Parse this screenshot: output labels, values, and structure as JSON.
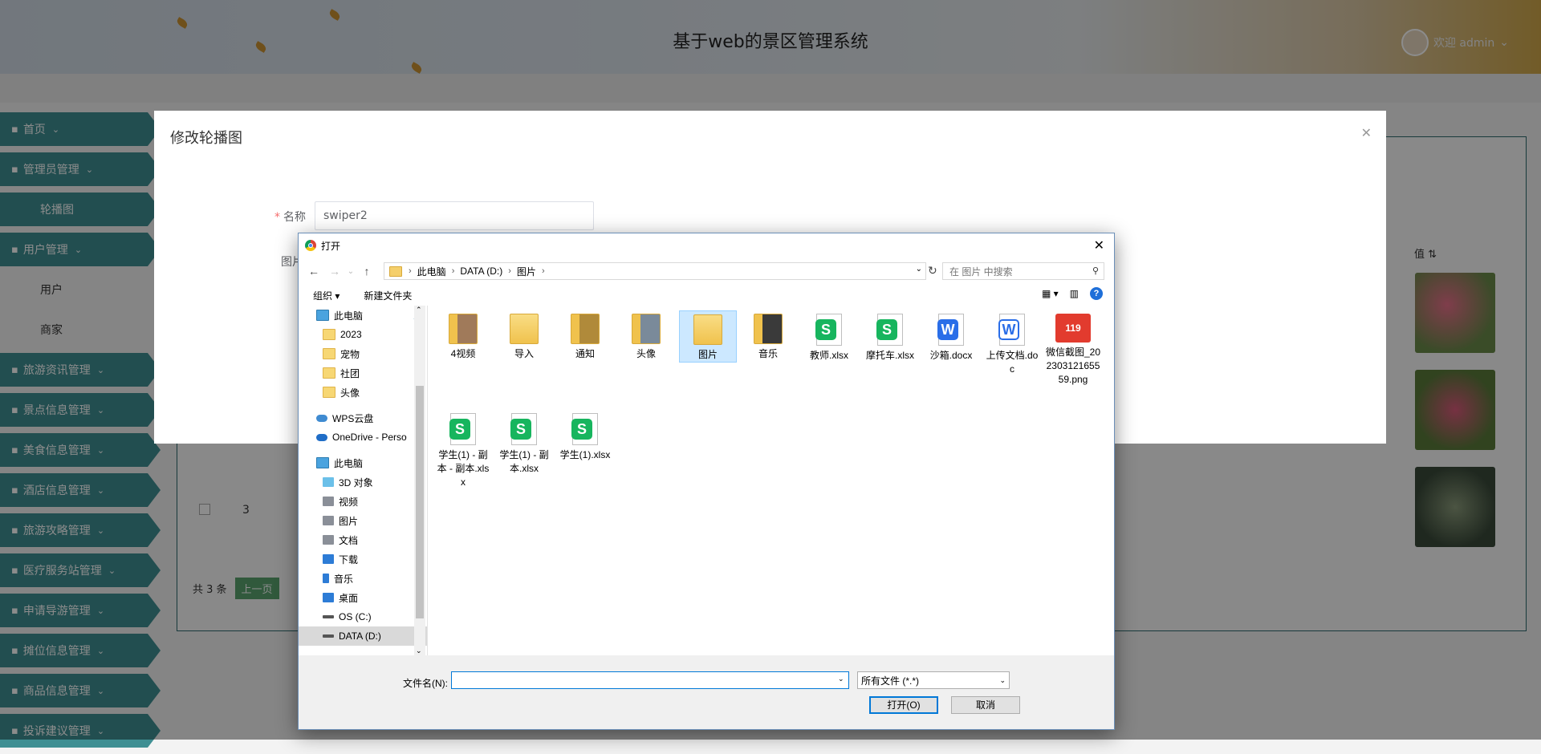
{
  "app": {
    "title": "基于web的景区管理系统",
    "welcome": "欢迎 admin"
  },
  "sidebar": {
    "items": [
      {
        "label": "首页",
        "icon": "home-icon"
      },
      {
        "label": "管理员管理",
        "icon": "admin-icon"
      },
      {
        "label": "轮播图",
        "sub": true
      },
      {
        "label": "用户管理",
        "icon": "user-icon"
      },
      {
        "label": "用户",
        "plain": true
      },
      {
        "label": "商家",
        "plain": true
      },
      {
        "label": "旅游资讯管理",
        "icon": "news-icon"
      },
      {
        "label": "景点信息管理",
        "icon": "scenic-icon"
      },
      {
        "label": "美食信息管理",
        "icon": "food-icon"
      },
      {
        "label": "酒店信息管理",
        "icon": "hotel-icon"
      },
      {
        "label": "旅游攻略管理",
        "icon": "guide-icon"
      },
      {
        "label": "医疗服务站管理",
        "icon": "medical-icon"
      },
      {
        "label": "申请导游管理",
        "icon": "apply-icon"
      },
      {
        "label": "摊位信息管理",
        "icon": "stall-icon"
      },
      {
        "label": "商品信息管理",
        "icon": "goods-icon"
      },
      {
        "label": "投诉建议管理",
        "icon": "complaint-icon"
      }
    ]
  },
  "table": {
    "col_value": "值",
    "row_num": "3",
    "total": "共 3 条",
    "prev": "上一页"
  },
  "modal": {
    "title": "修改轮播图",
    "name_label": "名称",
    "name_value": "swiper2",
    "image_label": "图片"
  },
  "dialog": {
    "title": "打开",
    "breadcrumb": [
      "此电脑",
      "DATA (D:)",
      "图片"
    ],
    "search_placeholder": "在 图片 中搜索",
    "toolbar": {
      "organize": "组织 ▾",
      "new_folder": "新建文件夹"
    },
    "tree": [
      {
        "label": "此电脑",
        "icon": "pc",
        "indent": 1,
        "pin": true
      },
      {
        "label": "2023",
        "icon": "folder",
        "indent": 2
      },
      {
        "label": "宠物",
        "icon": "folder",
        "indent": 2
      },
      {
        "label": "社团",
        "icon": "folder",
        "indent": 2
      },
      {
        "label": "头像",
        "icon": "folder",
        "indent": 2
      },
      {
        "label": "WPS云盘",
        "icon": "cloud",
        "indent": 1
      },
      {
        "label": "OneDrive - Perso",
        "icon": "cloud2",
        "indent": 1
      },
      {
        "label": "此电脑",
        "icon": "pc",
        "indent": 1
      },
      {
        "label": "3D 对象",
        "icon": "3d",
        "indent": 2
      },
      {
        "label": "视频",
        "icon": "gray",
        "indent": 2
      },
      {
        "label": "图片",
        "icon": "gray",
        "indent": 2
      },
      {
        "label": "文档",
        "icon": "gray",
        "indent": 2
      },
      {
        "label": "下载",
        "icon": "dl",
        "indent": 2
      },
      {
        "label": "音乐",
        "icon": "music",
        "indent": 2
      },
      {
        "label": "桌面",
        "icon": "dl",
        "indent": 2
      },
      {
        "label": "OS (C:)",
        "icon": "drive",
        "indent": 2
      },
      {
        "label": "DATA (D:)",
        "icon": "drive",
        "indent": 2,
        "selected": true
      }
    ],
    "files": [
      {
        "name": "4视频",
        "kind": "folder-img",
        "color": "#a07a5a"
      },
      {
        "name": "导入",
        "kind": "folder"
      },
      {
        "name": "通知",
        "kind": "folder-img",
        "color": "#b08a3a"
      },
      {
        "name": "头像",
        "kind": "folder-img",
        "color": "#7a8a9a"
      },
      {
        "name": "图片",
        "kind": "folder",
        "selected": true
      },
      {
        "name": "音乐",
        "kind": "folder-img",
        "color": "#3a3a3a"
      },
      {
        "name": "教师.xlsx",
        "kind": "s"
      },
      {
        "name": "摩托车.xlsx",
        "kind": "s"
      },
      {
        "name": "沙箱.docx",
        "kind": "w"
      },
      {
        "name": "上传文档.doc",
        "kind": "w2"
      },
      {
        "name": "微信截图_20230312165559.png",
        "kind": "img",
        "badge_text": "119"
      },
      {
        "name": "学生(1) - 副本 - 副本.xlsx",
        "kind": "s"
      },
      {
        "name": "学生(1) - 副本.xlsx",
        "kind": "s"
      },
      {
        "name": "学生(1).xlsx",
        "kind": "s"
      }
    ],
    "filename_label": "文件名(N):",
    "filename_value": "",
    "filetype": "所有文件 (*.*)",
    "open_button": "打开(O)",
    "cancel_button": "取消"
  }
}
